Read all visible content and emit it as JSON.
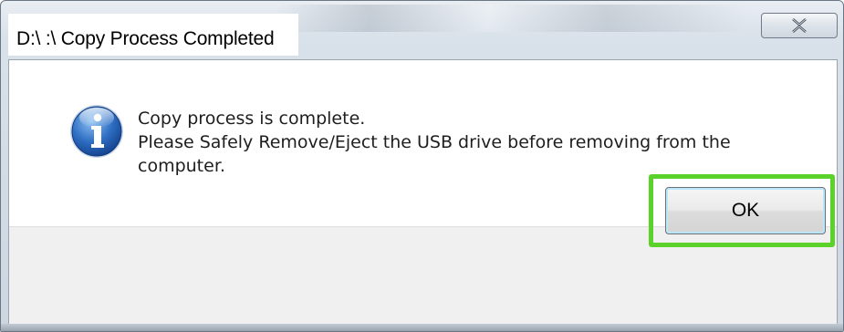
{
  "window": {
    "title": "D:\\ :\\ Copy Process Completed",
    "close_icon": "close-x-icon"
  },
  "message": {
    "icon": "information-icon",
    "line1": "Copy process is complete.",
    "line2": "Please Safely Remove/Eject the USB drive before removing from the",
    "line3": "computer."
  },
  "buttons": {
    "ok_label": "OK"
  },
  "colors": {
    "highlight": "#5ad22a",
    "info_icon": "#2f6fc4"
  }
}
